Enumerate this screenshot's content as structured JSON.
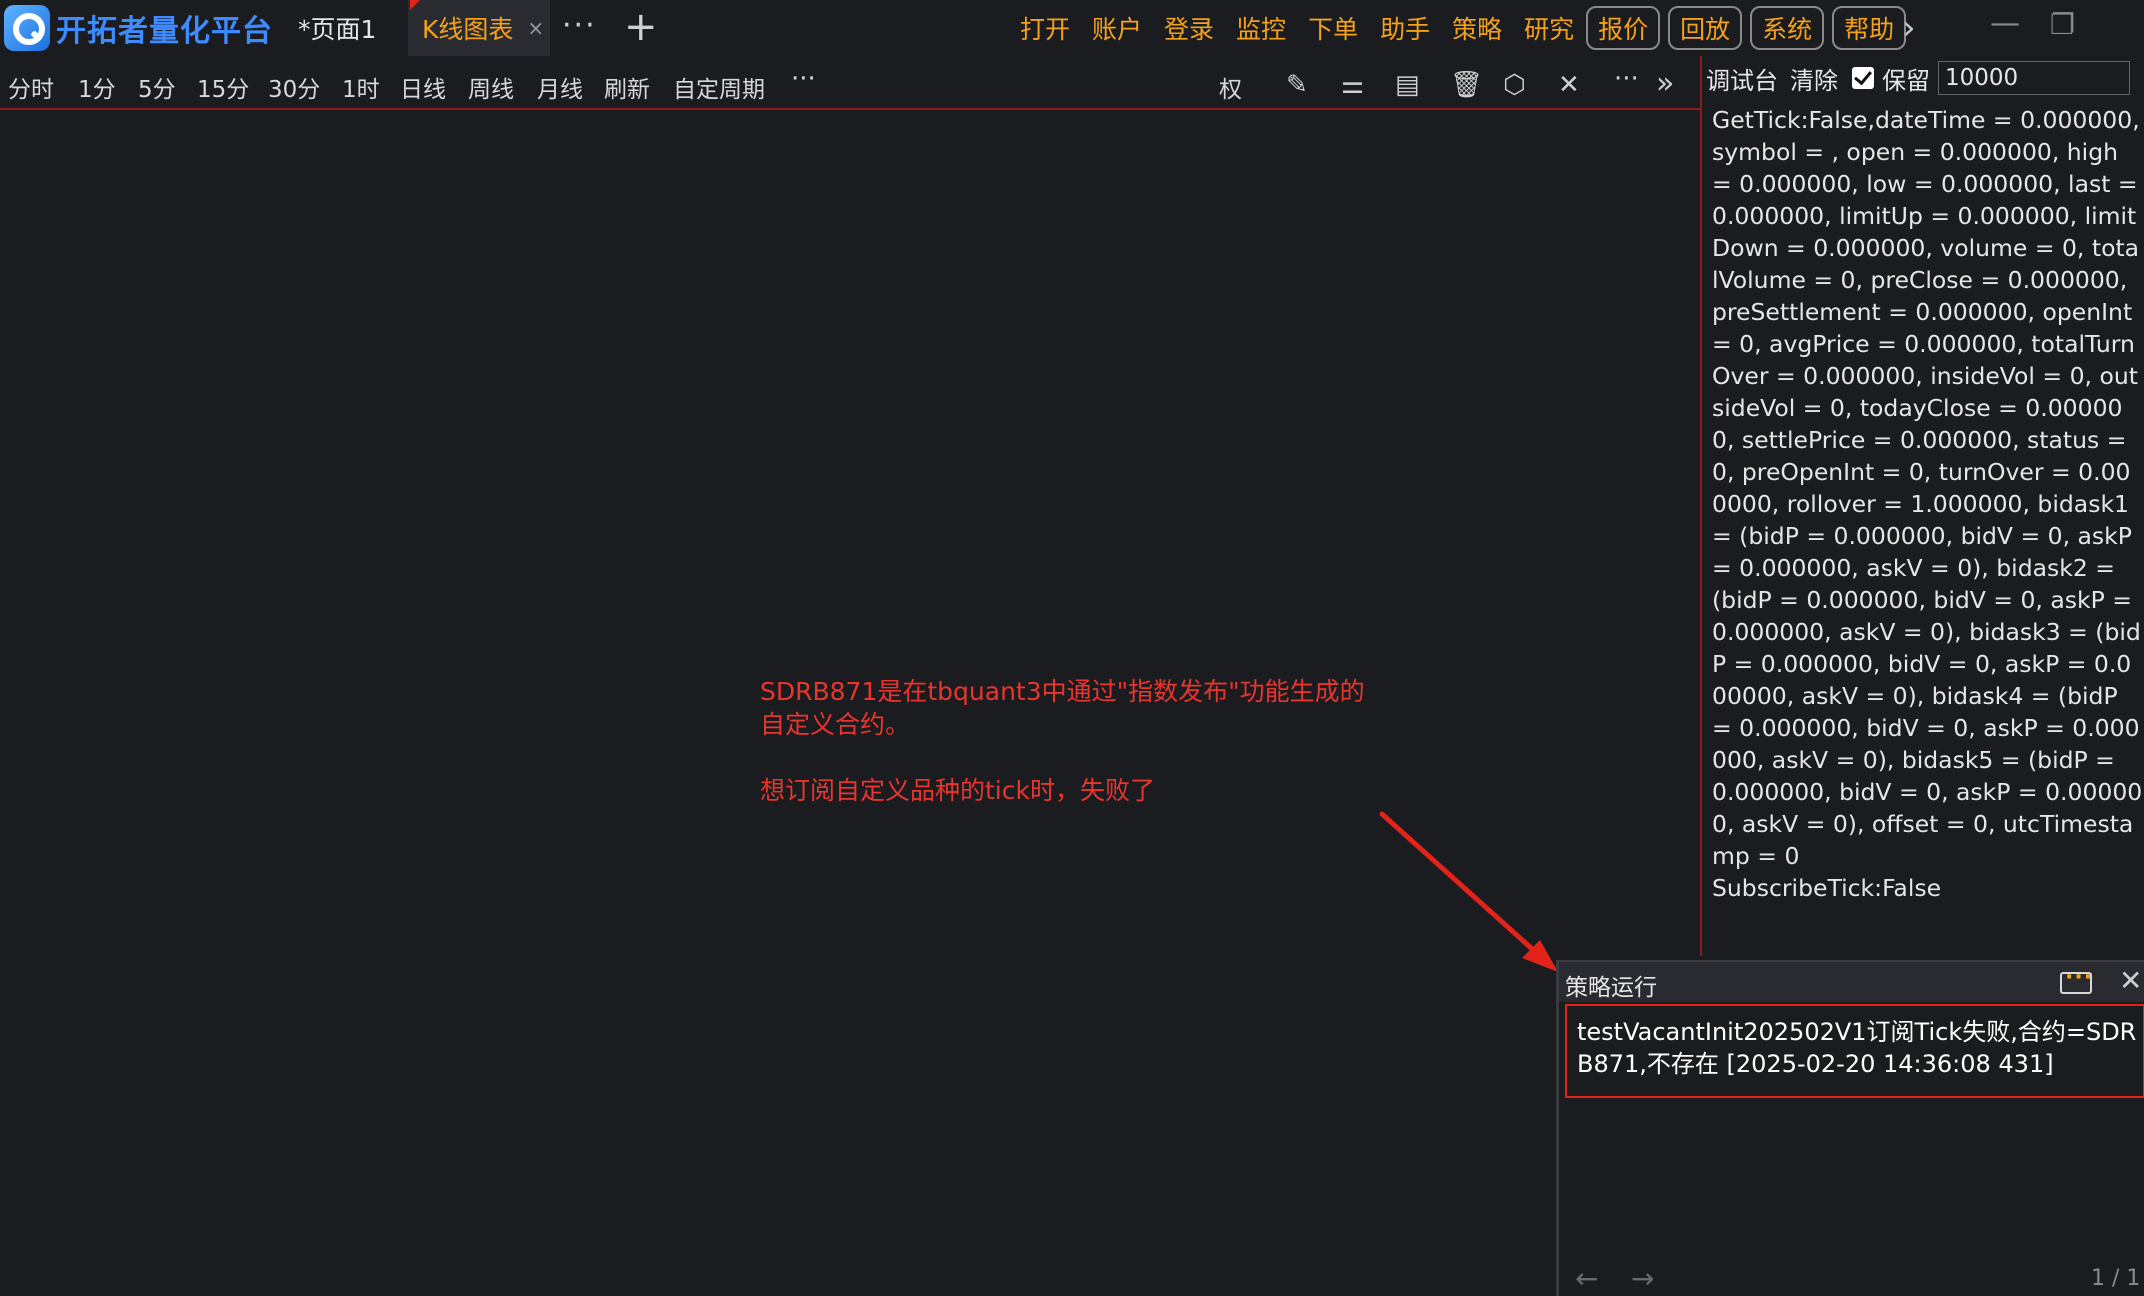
{
  "app": {
    "title": "开拓者量化平台",
    "tabs": [
      {
        "label": "*页面1",
        "active": false
      },
      {
        "label": "K线图表",
        "active": true,
        "close": "×"
      }
    ],
    "tab_more": "···",
    "tab_add": "+",
    "menu": [
      "打开",
      "账户",
      "登录",
      "监控",
      "下单",
      "助手",
      "策略",
      "研究"
    ],
    "menu_boxed": [
      "报价",
      "回放",
      "系统",
      "帮助"
    ],
    "accent_color": "#f5a21a"
  },
  "toolbar": {
    "periods": [
      "分时",
      "1分",
      "5分",
      "15分",
      "30分",
      "1时",
      "日线",
      "周线",
      "月线",
      "刷新",
      "自定周期",
      "···"
    ],
    "right_label": "权",
    "right_more": "···"
  },
  "debug": {
    "title": "调试台",
    "clear": "清除",
    "keep_label": "保留",
    "keep_checked": true,
    "keep_value": "10000",
    "lines": [
      "GetTick:False,dateTime = 0.000000, symbol = , open = 0.000000, high = 0.000000, low = 0.000000, last = 0.000000, limitUp = 0.000000, limitDown = 0.000000, volume = 0, totalVolume = 0, preClose = 0.000000, preSettlement = 0.000000, openInt = 0, avgPrice = 0.000000, totalTurnOver = 0.000000, insideVol = 0, outsideVol = 0, todayClose = 0.000000, settlePrice = 0.000000, status = 0, preOpenInt = 0, turnOver = 0.000000, rollover = 1.000000, bidask1 = (bidP = 0.000000, bidV = 0, askP = 0.000000, askV = 0), bidask2 = (bidP = 0.000000, bidV = 0, askP = 0.000000, askV = 0), bidask3 = (bidP = 0.000000, bidV = 0, askP = 0.000000, askV = 0), bidask4 = (bidP = 0.000000, bidV = 0, askP = 0.000000, askV = 0), bidask5 = (bidP = 0.000000, bidV = 0, askP = 0.000000, askV = 0), offset = 0, utcTimestamp = 0",
      "SubscribeTick:False"
    ]
  },
  "annotation": {
    "line1": "SDRB871是在tbquant3中通过\"指数发布\"功能生成的",
    "line2": "自定义合约。",
    "line3": "想订阅自定义品种的tick时，失败了",
    "color": "#e8362e"
  },
  "strategy": {
    "title": "策略运行",
    "message": "testVacantInit202502V1订阅Tick失败,合约=SDRB871,不存在 [2025-02-20 14:36:08 431]",
    "page": "1 / 1",
    "prev": "←",
    "next": "→"
  }
}
